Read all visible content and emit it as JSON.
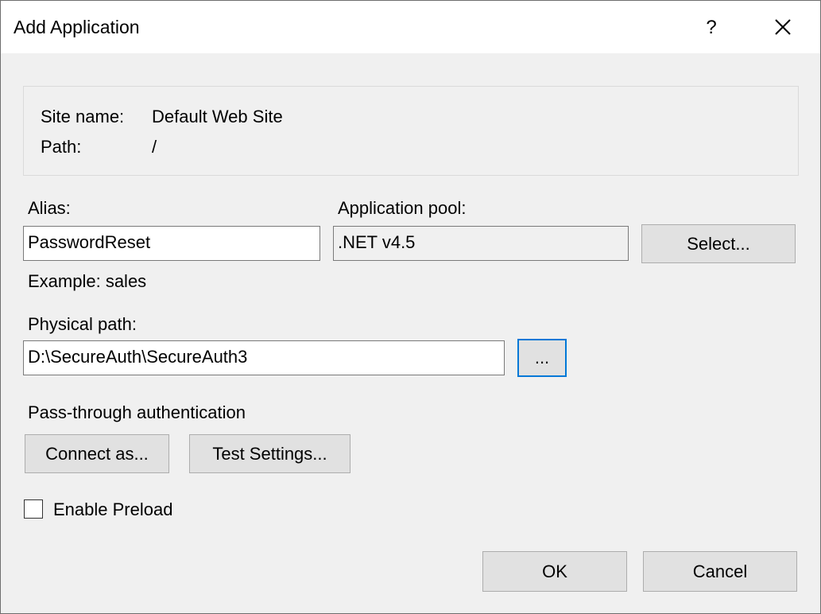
{
  "window": {
    "title": "Add Application",
    "help_glyph": "?",
    "close_icon": "close-icon",
    "help_icon": "help-icon"
  },
  "site_info": {
    "site_name_label": "Site name:",
    "site_name_value": "Default Web Site",
    "path_label": "Path:",
    "path_value": "/"
  },
  "alias": {
    "label": "Alias:",
    "value": "PasswordReset",
    "example": "Example: sales"
  },
  "app_pool": {
    "label": "Application pool:",
    "value": ".NET v4.5",
    "select_label": "Select..."
  },
  "physical_path": {
    "label": "Physical path:",
    "value": "D:\\SecureAuth\\SecureAuth3",
    "browse_label": "..."
  },
  "pass_through": {
    "label": "Pass-through authentication",
    "connect_as_label": "Connect as...",
    "test_settings_label": "Test Settings..."
  },
  "preload": {
    "label": "Enable Preload",
    "checked": false
  },
  "footer": {
    "ok_label": "OK",
    "cancel_label": "Cancel"
  },
  "colors": {
    "focus_border": "#0078d7",
    "dialog_bg": "#f0f0f0",
    "button_bg": "#e1e1e1"
  }
}
